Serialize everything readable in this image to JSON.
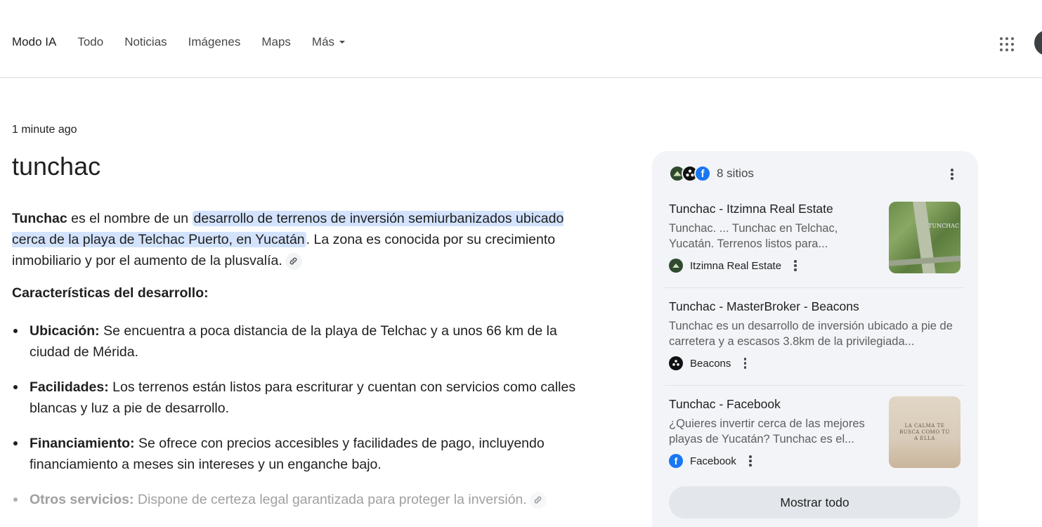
{
  "nav": {
    "tabs": [
      "Modo IA",
      "Todo",
      "Noticias",
      "Imágenes",
      "Maps",
      "Más"
    ],
    "active_tab": "Modo IA"
  },
  "result": {
    "timestamp": "1 minute ago",
    "query": "tunchac",
    "intro": {
      "bold": "Tunchac",
      "pre": " es el nombre de un ",
      "highlight": "desarrollo de terrenos de inversión semiurbanizados ubicado cerca de la playa de Telchac Puerto, en Yucatán",
      "post": ". La zona es conocida por su crecimiento inmobiliario y por el aumento de la plusvalía."
    },
    "section_title": "Características del desarrollo:",
    "bullets": [
      {
        "label": "Ubicación:",
        "text": " Se encuentra a poca distancia de la playa de Telchac y a unos 66 km de la ciudad de Mérida."
      },
      {
        "label": "Facilidades:",
        "text": " Los terrenos están listos para escriturar y cuentan con servicios como calles blancas y luz a pie de desarrollo."
      },
      {
        "label": "Financiamiento:",
        "text": " Se ofrece con precios accesibles y facilidades de pago, incluyendo financiamiento a meses sin intereses y un enganche bajo."
      },
      {
        "label": "Otros servicios:",
        "text": " Dispone de certeza legal garantizada para proteger la inversión."
      }
    ]
  },
  "sources": {
    "count_label": "8 sitios",
    "items": [
      {
        "title": "Tunchac - Itzimna Real Estate",
        "snippet": "Tunchac. ... Tunchac en Telchac, Yucatán. Terrenos listos para...",
        "site": "Itzimna Real Estate",
        "thumb_text": "TUNCHAC"
      },
      {
        "title": "Tunchac - MasterBroker - Beacons",
        "snippet": "Tunchac es un desarrollo de inversión ubicado a pie de carretera y a escasos 3.8km de la privilegiada...",
        "site": "Beacons"
      },
      {
        "title": "Tunchac - Facebook",
        "snippet": "¿Quieres invertir cerca de las mejores playas de Yucatán? Tunchac es el...",
        "site": "Facebook",
        "thumb_text": "LA CALMA TE BUSCA COMO TÚ A ELLA"
      }
    ],
    "show_all_label": "Mostrar todo"
  },
  "colors": {
    "highlight": "#d3e3fd",
    "panel_bg": "#f2f4f7",
    "facebook": "#1877f2"
  }
}
